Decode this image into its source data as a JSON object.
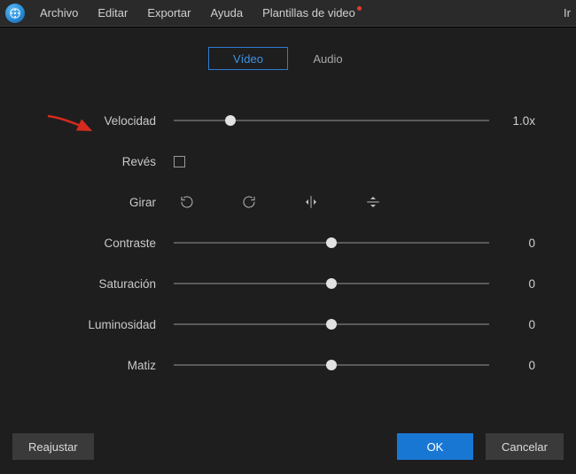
{
  "menu": {
    "items": [
      {
        "label": "Archivo"
      },
      {
        "label": "Editar"
      },
      {
        "label": "Exportar"
      },
      {
        "label": "Ayuda"
      },
      {
        "label": "Plantillas de video"
      }
    ],
    "right_cut": "Ir"
  },
  "tabs": {
    "video": "Vídeo",
    "audio": "Audio",
    "active": "video"
  },
  "rows": {
    "speed": {
      "label": "Velocidad",
      "value_text": "1.0x",
      "pos": 18
    },
    "reverse": {
      "label": "Revés",
      "checked": false
    },
    "rotate": {
      "label": "Girar"
    },
    "contrast": {
      "label": "Contraste",
      "value_text": "0",
      "pos": 50
    },
    "saturation": {
      "label": "Saturación",
      "value_text": "0",
      "pos": 50
    },
    "brightness": {
      "label": "Luminosidad",
      "value_text": "0",
      "pos": 50
    },
    "hue": {
      "label": "Matiz",
      "value_text": "0",
      "pos": 50
    }
  },
  "footer": {
    "reset": "Reajustar",
    "ok": "OK",
    "cancel": "Cancelar"
  },
  "colors": {
    "accent": "#1977d4",
    "arrow": "#d52b1e"
  }
}
